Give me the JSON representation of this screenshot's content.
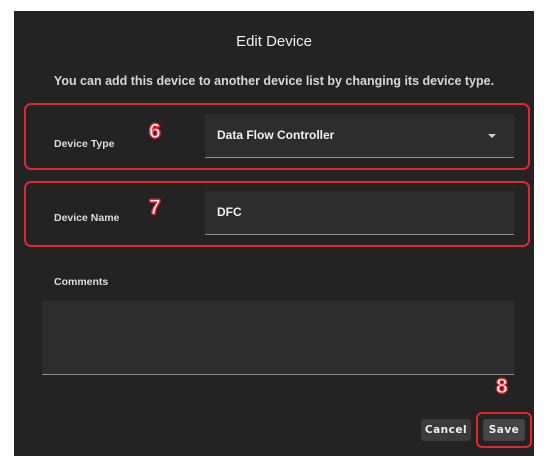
{
  "dialog": {
    "title": "Edit Device",
    "subtitle": "You can add this device to another device list by changing its device type."
  },
  "fields": {
    "device_type": {
      "label": "Device Type",
      "value": "Data Flow Controller",
      "badge": "6"
    },
    "device_name": {
      "label": "Device Name",
      "value": "DFC",
      "badge": "7"
    },
    "comments": {
      "label": "Comments",
      "value": ""
    }
  },
  "actions": {
    "cancel_label": "Cancel",
    "save_label": "Save",
    "save_badge": "8"
  },
  "colors": {
    "background": "#232323",
    "field_background": "#2d2d2d",
    "highlight": "#e2262f",
    "text": "#efefef"
  },
  "icons": {
    "device_type_dropdown": "caret-down-icon"
  }
}
